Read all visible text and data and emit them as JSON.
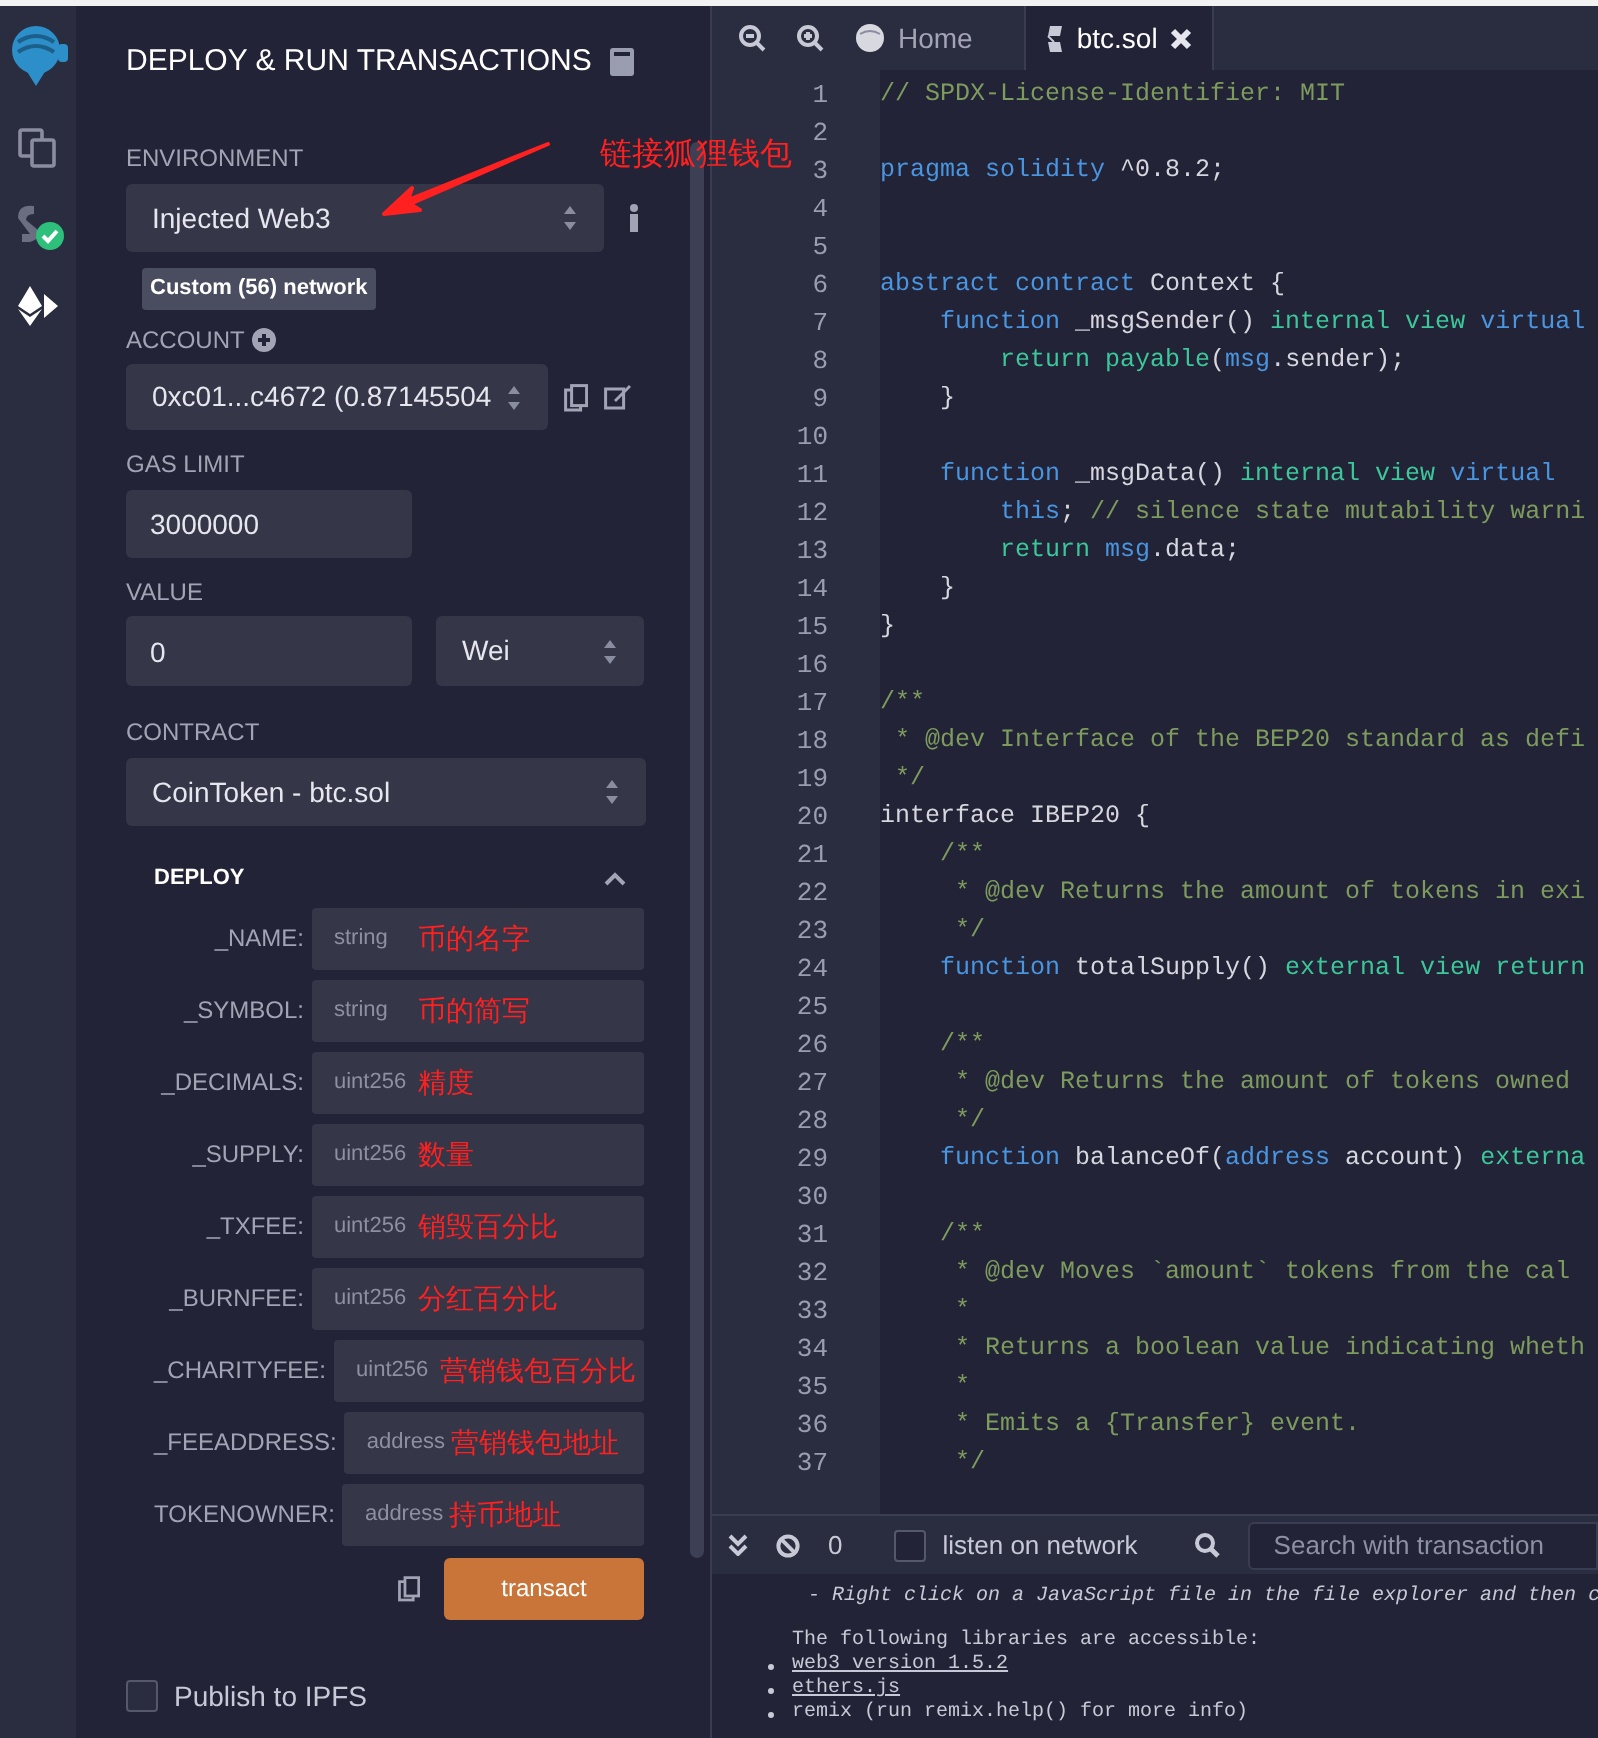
{
  "panel": {
    "title": "DEPLOY & RUN TRANSACTIONS",
    "environment": {
      "label": "ENVIRONMENT",
      "value": "Injected Web3",
      "note": "链接狐狸钱包",
      "network": "Custom (56) network"
    },
    "account": {
      "label": "ACCOUNT",
      "value": "0xc01...c4672 (0.87145504"
    },
    "gas_limit": {
      "label": "GAS LIMIT",
      "value": "3000000"
    },
    "value": {
      "label": "VALUE",
      "amount": "0",
      "unit": "Wei"
    },
    "contract": {
      "label": "CONTRACT",
      "value": "CoinToken - btc.sol"
    },
    "deploy": {
      "title": "DEPLOY",
      "expanded": true,
      "params": [
        {
          "name": "_NAME:",
          "placeholder": "string",
          "note": "币的名字"
        },
        {
          "name": "_SYMBOL:",
          "placeholder": "string",
          "note": "币的简写"
        },
        {
          "name": "_DECIMALS:",
          "placeholder": "uint256",
          "note": "精度"
        },
        {
          "name": "_SUPPLY:",
          "placeholder": "uint256",
          "note": "数量"
        },
        {
          "name": "_TXFEE:",
          "placeholder": "uint256",
          "note": "销毁百分比"
        },
        {
          "name": "_BURNFEE:",
          "placeholder": "uint256",
          "note": "分红百分比"
        },
        {
          "name": "_CHARITYFEE:",
          "placeholder": "uint256",
          "note": "营销钱包百分比"
        },
        {
          "name": "_FEEADDRESS:",
          "placeholder": "address",
          "note": "营销钱包地址"
        },
        {
          "name": "TOKENOWNER:",
          "placeholder": "address",
          "note": "持币地址"
        }
      ],
      "button": "transact"
    },
    "publish_ipfs": {
      "label": "Publish to IPFS",
      "checked": false
    }
  },
  "editor": {
    "tabs": [
      {
        "label": "Home",
        "kind": "home",
        "selected": false
      },
      {
        "label": "btc.sol",
        "kind": "file",
        "selected": true
      }
    ],
    "lines": [
      {
        "number": "1",
        "tokens": [
          {
            "text": "// SPDX-License-Identifier: MIT",
            "kind": "comment"
          }
        ]
      },
      {
        "number": "2"
      },
      {
        "number": "3",
        "tokens": [
          {
            "text": "pragma solidity",
            "kind": "keyword"
          },
          {
            "text": " ^0.8.2;",
            "kind": "plain"
          }
        ]
      },
      {
        "number": "4"
      },
      {
        "number": "5"
      },
      {
        "number": "6",
        "tokens": [
          {
            "text": "abstract contract",
            "kind": "keyword"
          },
          {
            "text": " Context {",
            "kind": "plain"
          }
        ]
      },
      {
        "number": "7",
        "tokens": [
          {
            "text": "    function",
            "kind": "keyword"
          },
          {
            "text": " _msgSender()",
            "kind": "plain"
          },
          {
            "text": " internal view",
            "kind": "modifier"
          },
          {
            "text": " virtual",
            "kind": "keyword"
          }
        ]
      },
      {
        "number": "8",
        "tokens": [
          {
            "text": "        return payable",
            "kind": "modifier"
          },
          {
            "text": "(",
            "kind": "plain"
          },
          {
            "text": "msg",
            "kind": "keyword"
          },
          {
            "text": ".sender);",
            "kind": "plain"
          }
        ]
      },
      {
        "number": "9",
        "tokens": [
          {
            "text": "    }",
            "kind": "plain"
          }
        ]
      },
      {
        "number": "10"
      },
      {
        "number": "11",
        "tokens": [
          {
            "text": "    function",
            "kind": "keyword"
          },
          {
            "text": " _msgData()",
            "kind": "plain"
          },
          {
            "text": " internal view",
            "kind": "modifier"
          },
          {
            "text": " virtual",
            "kind": "keyword"
          }
        ]
      },
      {
        "number": "12",
        "tokens": [
          {
            "text": "        this",
            "kind": "keyword"
          },
          {
            "text": ";",
            "kind": "plain"
          },
          {
            "text": " // silence state mutability warni",
            "kind": "comment"
          }
        ]
      },
      {
        "number": "13",
        "tokens": [
          {
            "text": "        return",
            "kind": "modifier"
          },
          {
            "text": " msg",
            "kind": "keyword"
          },
          {
            "text": ".data;",
            "kind": "plain"
          }
        ]
      },
      {
        "number": "14",
        "tokens": [
          {
            "text": "    }",
            "kind": "plain"
          }
        ]
      },
      {
        "number": "15",
        "tokens": [
          {
            "text": "}",
            "kind": "plain"
          }
        ]
      },
      {
        "number": "16"
      },
      {
        "number": "17",
        "tokens": [
          {
            "text": "/**",
            "kind": "comment"
          }
        ]
      },
      {
        "number": "18",
        "tokens": [
          {
            "text": " * @dev Interface of the BEP20 standard as defi",
            "kind": "comment"
          }
        ]
      },
      {
        "number": "19",
        "tokens": [
          {
            "text": " */",
            "kind": "comment"
          }
        ]
      },
      {
        "number": "20",
        "tokens": [
          {
            "text": "interface IBEP20 {",
            "kind": "plain"
          }
        ]
      },
      {
        "number": "21",
        "tokens": [
          {
            "text": "    /**",
            "kind": "comment"
          }
        ]
      },
      {
        "number": "22",
        "tokens": [
          {
            "text": "     * @dev Returns the amount of tokens in exi",
            "kind": "comment"
          }
        ]
      },
      {
        "number": "23",
        "tokens": [
          {
            "text": "     */",
            "kind": "comment"
          }
        ]
      },
      {
        "number": "24",
        "tokens": [
          {
            "text": "    function",
            "kind": "keyword"
          },
          {
            "text": " totalSupply()",
            "kind": "plain"
          },
          {
            "text": " external view return",
            "kind": "modifier"
          }
        ]
      },
      {
        "number": "25"
      },
      {
        "number": "26",
        "tokens": [
          {
            "text": "    /**",
            "kind": "comment"
          }
        ]
      },
      {
        "number": "27",
        "tokens": [
          {
            "text": "     * @dev Returns the amount of tokens owned",
            "kind": "comment"
          }
        ]
      },
      {
        "number": "28",
        "tokens": [
          {
            "text": "     */",
            "kind": "comment"
          }
        ]
      },
      {
        "number": "29",
        "tokens": [
          {
            "text": "    function",
            "kind": "keyword"
          },
          {
            "text": " balanceOf(",
            "kind": "plain"
          },
          {
            "text": "address",
            "kind": "keyword"
          },
          {
            "text": " account)",
            "kind": "plain"
          },
          {
            "text": " externa",
            "kind": "modifier"
          }
        ]
      },
      {
        "number": "30"
      },
      {
        "number": "31",
        "tokens": [
          {
            "text": "    /**",
            "kind": "comment"
          }
        ]
      },
      {
        "number": "32",
        "tokens": [
          {
            "text": "     * @dev Moves `amount` tokens from the cal",
            "kind": "comment"
          }
        ]
      },
      {
        "number": "33",
        "tokens": [
          {
            "text": "     *",
            "kind": "comment"
          }
        ]
      },
      {
        "number": "34",
        "tokens": [
          {
            "text": "     * Returns a boolean value indicating wheth",
            "kind": "comment"
          }
        ]
      },
      {
        "number": "35",
        "tokens": [
          {
            "text": "     *",
            "kind": "comment"
          }
        ]
      },
      {
        "number": "36",
        "tokens": [
          {
            "text": "     * Emits a {Transfer} event.",
            "kind": "comment"
          }
        ]
      },
      {
        "number": "37",
        "tokens": [
          {
            "text": "     */",
            "kind": "comment"
          }
        ]
      }
    ]
  },
  "terminal": {
    "count": "0",
    "listen": {
      "label": "listen on network",
      "checked": false
    },
    "search_placeholder": "Search with transaction",
    "lines": [
      {
        "kind": "italic",
        "text": "- Right click on a JavaScript file in the file explorer and then c"
      },
      {
        "kind": "plain",
        "text": "The following libraries are accessible:"
      },
      {
        "kind": "link",
        "text": "web3 version 1.5.2"
      },
      {
        "kind": "link",
        "text": "ethers.js"
      },
      {
        "kind": "bullet",
        "text": "remix (run remix.help() for more info)"
      }
    ]
  }
}
